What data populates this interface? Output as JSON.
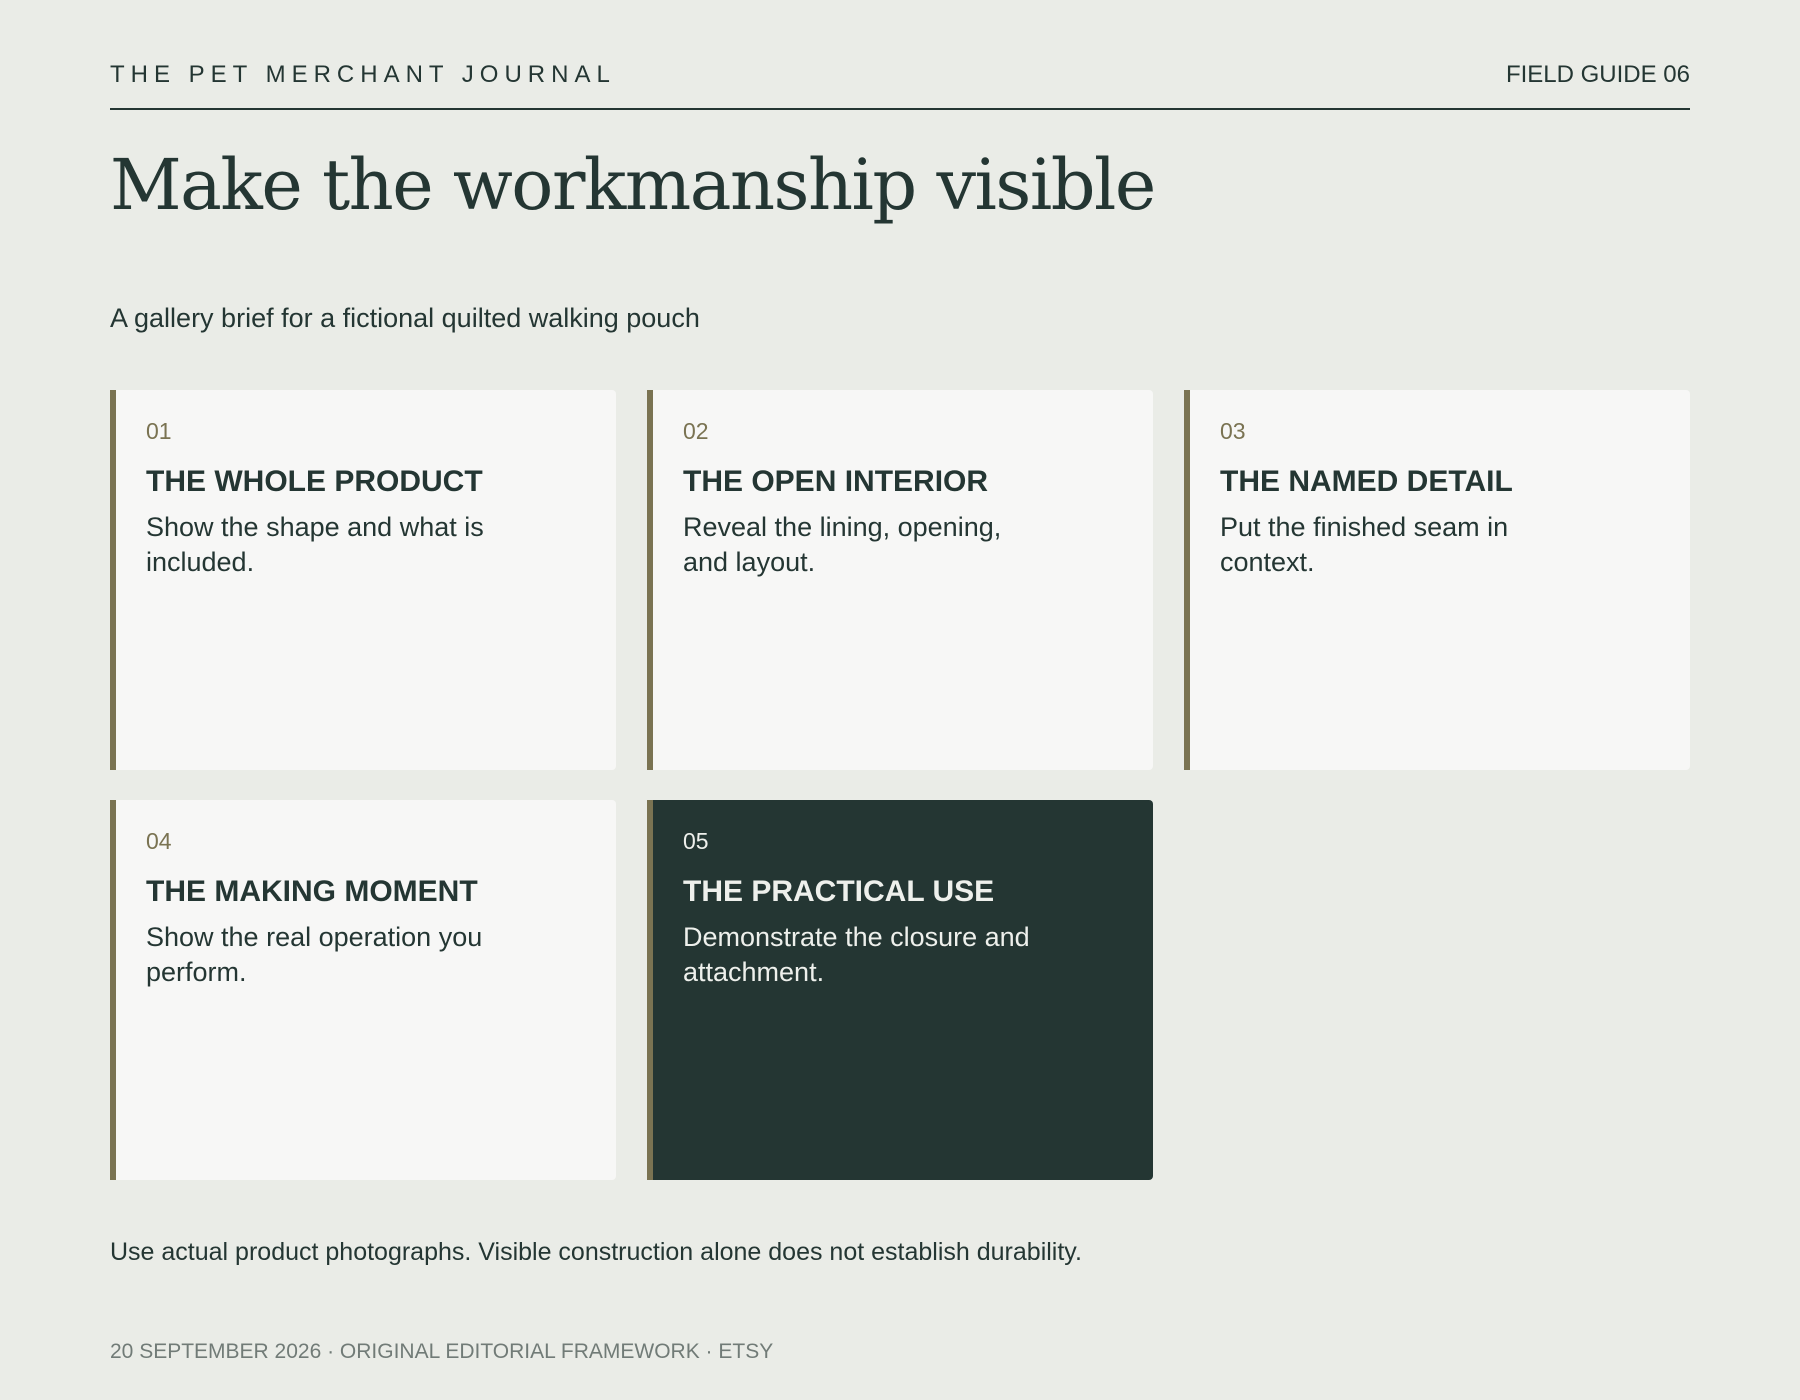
{
  "header": {
    "journal_name": "THE PET MERCHANT JOURNAL",
    "issue_label": "FIELD GUIDE 06"
  },
  "title": "Make the workmanship visible",
  "subtitle": "A gallery brief for a fictional quilted walking pouch",
  "cards": [
    {
      "number": "01",
      "title": "THE WHOLE PRODUCT",
      "description": "Show the shape and what is included."
    },
    {
      "number": "02",
      "title": "THE OPEN INTERIOR",
      "description": "Reveal the lining, opening, and layout."
    },
    {
      "number": "03",
      "title": "THE NAMED DETAIL",
      "description": "Put the finished seam in context."
    },
    {
      "number": "04",
      "title": "THE MAKING MOMENT",
      "description": "Show the real operation you perform."
    },
    {
      "number": "05",
      "title": "THE PRACTICAL USE",
      "description": "Demonstrate the closure and attachment."
    }
  ],
  "note": "Use actual product photographs. Visible construction alone does not establish durability.",
  "colophon": "20 SEPTEMBER 2026 · ORIGINAL EDITORIAL FRAMEWORK · ETSY",
  "colors": {
    "background": "#eaece7",
    "ink": "#243633",
    "accent": "#7a7352",
    "card": "#f7f7f6",
    "highlight_card": "#243633",
    "muted": "#717b77"
  }
}
